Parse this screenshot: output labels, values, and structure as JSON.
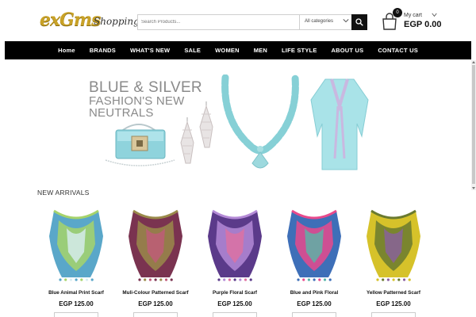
{
  "header": {
    "logo_text": "exGms",
    "logo_sub": "Shopping",
    "search_placeholder": "Search Products...",
    "category_select": "All categories",
    "cart_label": "My cart",
    "cart_amount": "EGP 0.00",
    "cart_count": "0"
  },
  "nav": {
    "items": [
      "Home",
      "BRANDS",
      "WHAT'S NEW",
      "SALE",
      "WOMEN",
      "MEN",
      "LIFE STYLE",
      "ABOUT US",
      "CONTACT US"
    ]
  },
  "banner": {
    "line1": "BLUE & SILVER",
    "line2": "FASHION'S NEW",
    "line3": "NEUTRALS"
  },
  "new_arrivals": {
    "title": "NEW ARRIVALS",
    "products": [
      {
        "name": "Blue Animal Print Scarf",
        "price": "EGP 125.00",
        "colors": [
          "#5aa7c9",
          "#a6d36b",
          "#d8eef2"
        ]
      },
      {
        "name": "Muli-Colour Patterned Scarf",
        "price": "EGP 125.00",
        "colors": [
          "#7a3350",
          "#9a8a4a",
          "#c05a7a"
        ]
      },
      {
        "name": "Purple Floral Scarf",
        "price": "EGP 125.00",
        "colors": [
          "#5b3a8a",
          "#b48ad6",
          "#e070a0"
        ]
      },
      {
        "name": "Blue and Pink Floral",
        "price": "EGP 125.00",
        "colors": [
          "#3e6fb8",
          "#e84a8c",
          "#57b6a8"
        ]
      },
      {
        "name": "Yellow Patterned Scarf",
        "price": "EGP 125.00",
        "colors": [
          "#d6c22a",
          "#6a7a2f",
          "#8a5fa0"
        ]
      }
    ]
  }
}
